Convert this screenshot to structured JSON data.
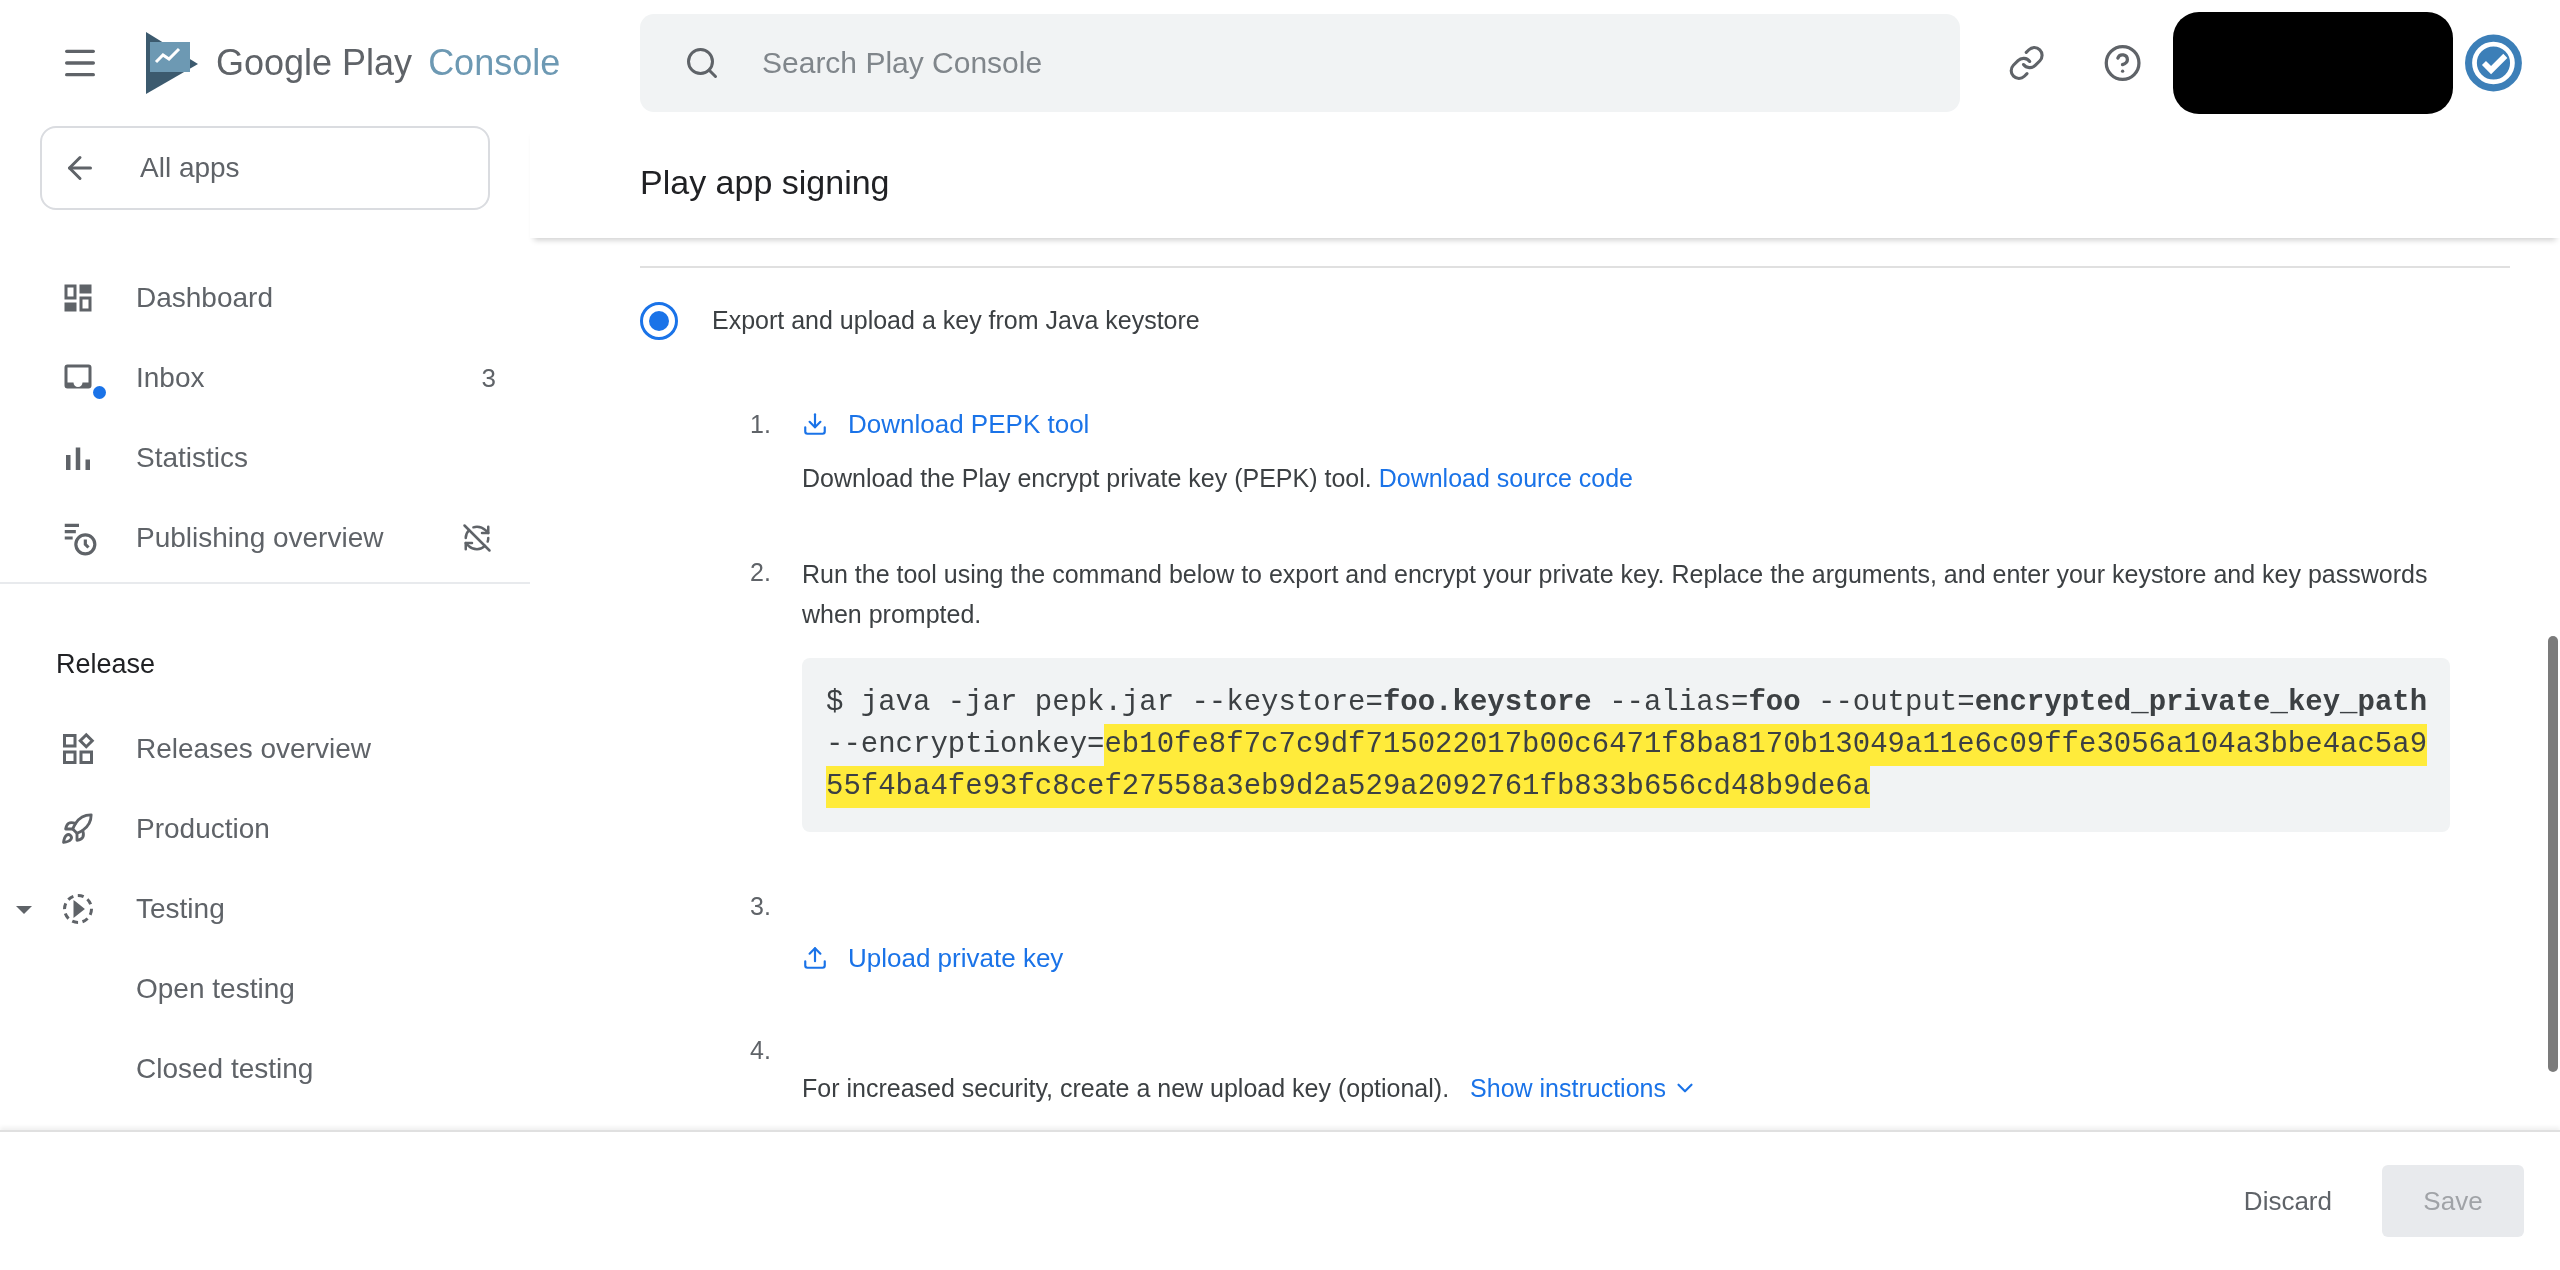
{
  "logo": {
    "name": "Google Play",
    "product": "Console"
  },
  "all_apps": "All apps",
  "nav": [
    {
      "kind": "dashboard",
      "label": "Dashboard"
    },
    {
      "kind": "inbox",
      "label": "Inbox",
      "count": "3",
      "unread_dot": true
    },
    {
      "kind": "statistics",
      "label": "Statistics"
    },
    {
      "kind": "publishing",
      "label": "Publishing overview",
      "sync_off": true
    }
  ],
  "section": "Release",
  "release_nav": [
    {
      "kind": "releases",
      "label": "Releases overview"
    },
    {
      "kind": "production",
      "label": "Production"
    },
    {
      "kind": "testing",
      "label": "Testing",
      "expanded": true,
      "children": [
        {
          "label": "Open testing"
        },
        {
          "label": "Closed testing"
        }
      ]
    }
  ],
  "search": {
    "placeholder": "Search Play Console"
  },
  "page_title": "Play app signing",
  "option": {
    "label": "Export and upload a key from Java keystore",
    "selected": true
  },
  "steps": [
    {
      "number": "1.",
      "link": {
        "kind": "download",
        "text": "Download PEPK tool"
      },
      "description": "Download the Play encrypt private key (PEPK) tool.",
      "description_link": "Download source code"
    },
    {
      "number": "2.",
      "description": "Run the tool using the command below to export and encrypt your private key. Replace the arguments, and enter your keystore and key passwords when prompted.",
      "command": [
        [
          {
            "text": "$ java -jar pepk.jar --keystore=**foo.keystore** --alias=**foo** --output=**encrypted_private_key_path**",
            "highlighted": false
          }
        ],
        [
          {
            "text": "--encryptionkey=",
            "highlighted": false
          },
          {
            "text": "eb10fe8f7c7c9df715022017b00c6471f8ba8170b13049a11e6c09ffe3056a104a3bbe4ac5a9",
            "highlighted": true
          }
        ],
        [
          {
            "text": "55f4ba4fe93fc8cef27558a3eb9d2a529a2092761fb833b656cd48b9de6a",
            "highlighted": true
          }
        ]
      ]
    },
    {
      "number": "3.",
      "link": {
        "kind": "upload",
        "text": "Upload private key"
      }
    },
    {
      "number": "4.",
      "description": "For increased security, create a new upload key (optional).",
      "toggle": "Show instructions"
    }
  ],
  "footer": {
    "discard": "Discard",
    "save": {
      "label": "Save",
      "disabled": true
    }
  }
}
